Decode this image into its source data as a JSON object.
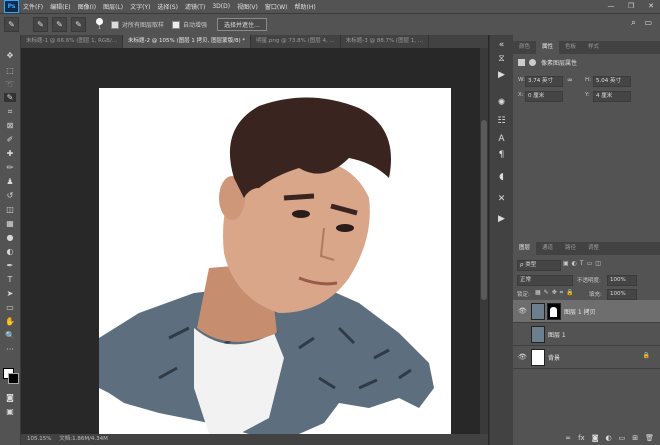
{
  "app": {
    "logo": "Ps"
  },
  "menu": [
    "文件(F)",
    "编辑(E)",
    "图像(I)",
    "图层(L)",
    "文字(Y)",
    "选择(S)",
    "滤镜(T)",
    "3D(D)",
    "视图(V)",
    "窗口(W)",
    "帮助(H)"
  ],
  "window_controls": {
    "minimize": "—",
    "restore": "❐",
    "close": "✕"
  },
  "options": {
    "brush_size": "1",
    "sample_all_layers": "对所有图层取样",
    "auto_enhance": "自动增强",
    "select_subject": "选择并遮住..."
  },
  "tabs": [
    {
      "label": "未标题-1 @ 66.6% (图层 1, RGB/...",
      "active": false
    },
    {
      "label": "未标题-2 @ 105% (图层 1 拷贝, 图层蒙版/8) *",
      "active": true
    },
    {
      "label": "明星.png @ 73.8% (图层 4, ...",
      "active": false
    },
    {
      "label": "未标题-3 @ 88.7% (图层 1, ...",
      "active": false
    }
  ],
  "status": {
    "zoom": "105.15%",
    "doc": "文档:1.86M/4.34M"
  },
  "properties": {
    "tabs": [
      "颜色",
      "属性",
      "色板",
      "样式"
    ],
    "active_tab": "属性",
    "header": "像素图层属性",
    "w_label": "W:",
    "w": "3.74 英寸",
    "h_label": "H:",
    "h": "5.04 英寸",
    "x_label": "X:",
    "x": "0 厘米",
    "y_label": "Y:",
    "y": "4 厘米",
    "link_icon": "link-icon"
  },
  "layers_panel": {
    "tabs": [
      "图层",
      "通道",
      "路径",
      "调整"
    ],
    "active_tab": "图层",
    "filter": "ρ 类型",
    "blend": "正常",
    "opacity_label": "不透明度:",
    "opacity": "100%",
    "lock_label": "锁定:",
    "fill_label": "填充:",
    "fill": "100%",
    "layers": [
      {
        "name": "图层 1 拷贝",
        "selected": true,
        "visible": true,
        "has_mask": true
      },
      {
        "name": "图层 1",
        "selected": false,
        "visible": false,
        "has_mask": false
      },
      {
        "name": "背景",
        "selected": false,
        "visible": true,
        "has_mask": false,
        "locked": true
      }
    ],
    "bottom_icons": [
      "link-icon",
      "fx-icon",
      "mask-icon",
      "adjustment-icon",
      "group-icon",
      "new-layer-icon",
      "trash-icon"
    ]
  }
}
